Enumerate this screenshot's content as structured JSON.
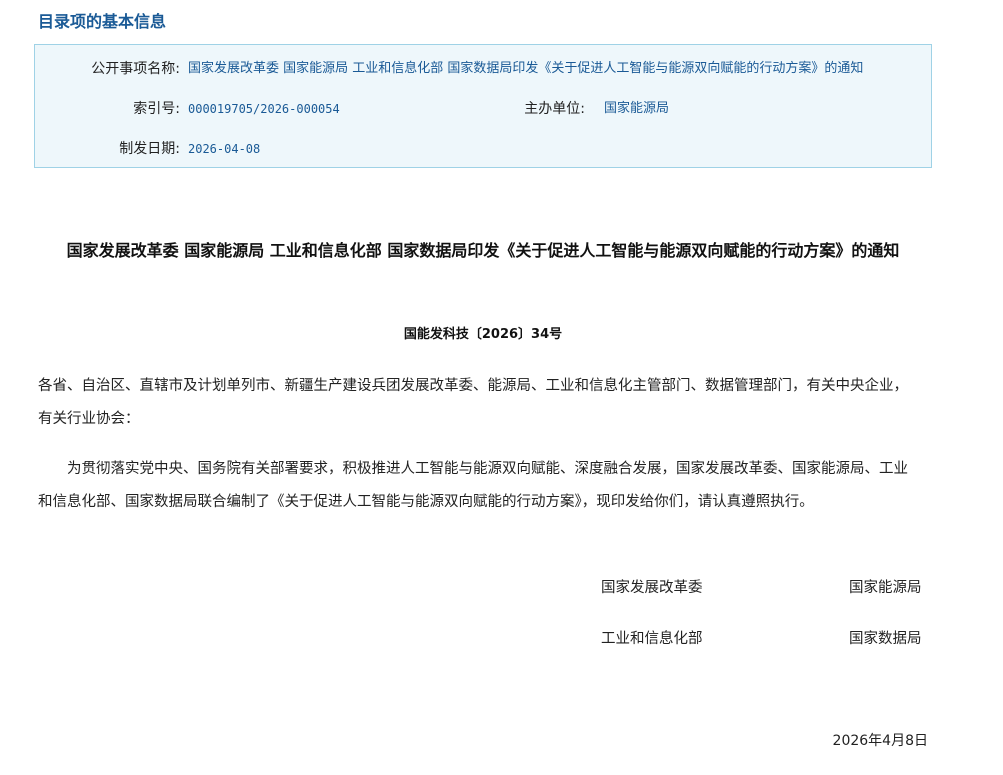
{
  "section": {
    "title": "目录项的基本信息"
  },
  "info": {
    "item_name_label": "公开事项名称:",
    "item_name_value": "国家发展改革委  国家能源局  工业和信息化部  国家数据局印发《关于促进人工智能与能源双向赋能的行动方案》的通知",
    "index_label": "索引号:",
    "index_value": "000019705/2026-000054",
    "host_label": "主办单位:",
    "host_value": "国家能源局",
    "date_label": "制发日期:",
    "date_value": "2026-04-08"
  },
  "document": {
    "title": "国家发展改革委  国家能源局  工业和信息化部  国家数据局印发《关于促进人工智能与能源双向赋能的行动方案》的通知",
    "number": "国能发科技〔2026〕34号",
    "addressees": "各省、自治区、直辖市及计划单列市、新疆生产建设兵团发展改革委、能源局、工业和信息化主管部门、数据管理部门，有关中央企业，有关行业协会：",
    "body": "为贯彻落实党中央、国务院有关部署要求，积极推进人工智能与能源双向赋能、深度融合发展，国家发展改革委、国家能源局、工业和信息化部、国家数据局联合编制了《关于促进人工智能与能源双向赋能的行动方案》，现印发给你们，请认真遵照执行。",
    "signers": [
      "国家发展改革委",
      "国家能源局",
      "工业和信息化部",
      "国家数据局"
    ],
    "date": "2026年4月8日"
  }
}
